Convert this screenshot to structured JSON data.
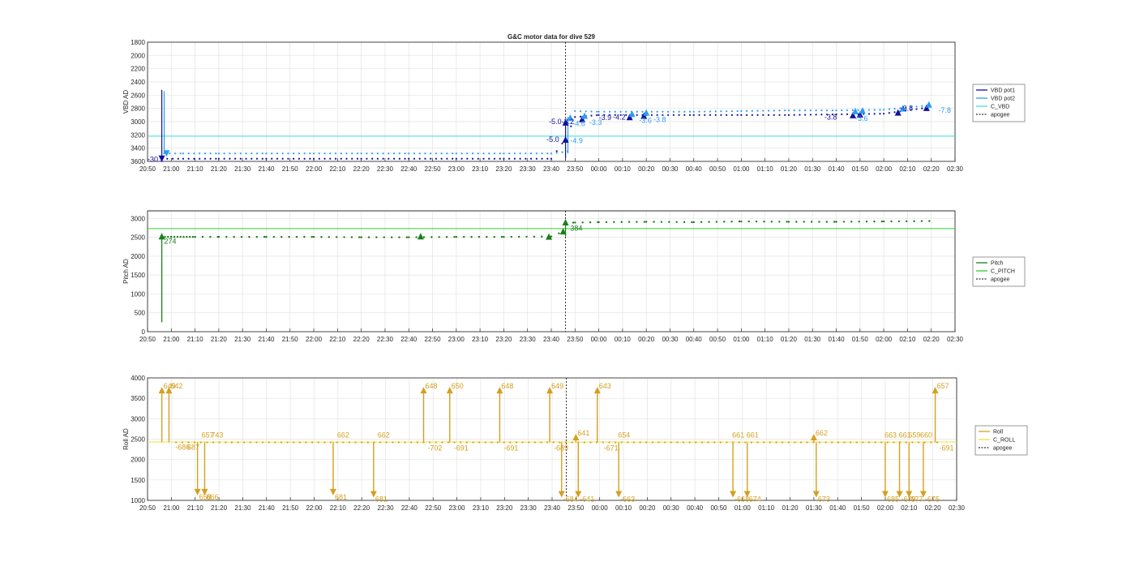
{
  "figure": {
    "title": "G&C motor data for dive 529"
  },
  "chart_data": [
    {
      "type": "line",
      "ylabel": "VBD AD",
      "xlabel": "",
      "ylim": [
        1800,
        3600
      ],
      "y_reversed": true,
      "yticks": [
        1800,
        2000,
        2200,
        2400,
        2600,
        2800,
        3000,
        3200,
        3400,
        3600
      ],
      "xticks": [
        "20:50",
        "21:00",
        "21:10",
        "21:20",
        "21:30",
        "21:40",
        "21:50",
        "22:00",
        "22:10",
        "22:20",
        "22:30",
        "22:40",
        "22:50",
        "23:00",
        "23:10",
        "23:20",
        "23:30",
        "23:40",
        "23:50",
        "00:00",
        "00:10",
        "00:20",
        "00:30",
        "00:40",
        "00:50",
        "01:00",
        "01:10",
        "01:20",
        "01:30",
        "01:40",
        "01:50",
        "02:00",
        "02:10",
        "02:20",
        "02:30"
      ],
      "grid": true,
      "legend_position": "right",
      "legend": [
        "VBD pot1",
        "VBD pot2",
        "C_VBD",
        "apogee"
      ],
      "colors": {
        "pot1": "#1010a0",
        "pot2": "#2a9df4",
        "c_vbd": "#40e0e0",
        "apogee": "#000000"
      },
      "apogee_x": "23:46",
      "c_vbd_value": 3220,
      "series": [
        {
          "name": "VBD pot1",
          "x": [
            "20:56",
            "21:05",
            "21:20",
            "21:40",
            "22:00",
            "22:20",
            "22:40",
            "23:00",
            "23:20",
            "23:40",
            "23:46",
            "23:50",
            "00:00",
            "00:20",
            "00:40",
            "01:00",
            "01:20",
            "01:40",
            "02:00",
            "02:20"
          ],
          "values": [
            3560,
            3560,
            3560,
            3560,
            3560,
            3560,
            3560,
            3560,
            3560,
            3560,
            3260,
            2930,
            2900,
            2900,
            2900,
            2900,
            2900,
            2890,
            2880,
            2780
          ]
        },
        {
          "name": "VBD pot2",
          "x": [
            "20:57",
            "21:05",
            "21:20",
            "21:40",
            "22:00",
            "22:20",
            "22:40",
            "23:00",
            "23:20",
            "23:40",
            "23:47",
            "23:50",
            "00:00",
            "00:20",
            "00:40",
            "01:00",
            "01:20",
            "01:40",
            "02:00",
            "02:20"
          ],
          "values": [
            3480,
            3480,
            3480,
            3480,
            3480,
            3480,
            3480,
            3480,
            3480,
            3480,
            3450,
            2840,
            2850,
            2850,
            2850,
            2840,
            2830,
            2830,
            2820,
            2750
          ]
        }
      ],
      "annotations": [
        {
          "x": "20:50",
          "y": 3570,
          "text": "-30.2",
          "color": "#1010a0"
        },
        {
          "x": "23:39",
          "y": 3000,
          "text": "-5.0-3.2",
          "color": "#1010a0"
        },
        {
          "x": "23:38",
          "y": 3270,
          "text": "-5.0",
          "color": "#1010a0"
        },
        {
          "x": "23:49",
          "y": 3030,
          "text": "-4.6",
          "color": "#2a9df4"
        },
        {
          "x": "23:56",
          "y": 3010,
          "text": "-3.3",
          "color": "#2a9df4"
        },
        {
          "x": "23:48",
          "y": 3290,
          "text": "-4.9",
          "color": "#2a9df4"
        },
        {
          "x": "00:00",
          "y": 2940,
          "text": "-3.9",
          "color": "#1010a0"
        },
        {
          "x": "00:06",
          "y": 2930,
          "text": "-4.2",
          "color": "#1010a0"
        },
        {
          "x": "00:17",
          "y": 2980,
          "text": "-3.6",
          "color": "#2a9df4"
        },
        {
          "x": "00:23",
          "y": 2970,
          "text": "-3.8",
          "color": "#2a9df4"
        },
        {
          "x": "01:35",
          "y": 2930,
          "text": "-3.8",
          "color": "#1010a0"
        },
        {
          "x": "01:48",
          "y": 2950,
          "text": "-3.6",
          "color": "#2a9df4"
        },
        {
          "x": "02:07",
          "y": 2800,
          "text": "-9.8",
          "color": "#1010a0"
        },
        {
          "x": "02:23",
          "y": 2830,
          "text": "-7.8",
          "color": "#2a9df4"
        }
      ],
      "markers": [
        {
          "x": "20:56",
          "y": 3560,
          "dir": "down",
          "color": "#1010a0"
        },
        {
          "x": "20:58",
          "y": 3480,
          "dir": "down",
          "color": "#2a9df4"
        },
        {
          "x": "23:46",
          "y": 3270,
          "dir": "up",
          "color": "#1010a0"
        },
        {
          "x": "23:46",
          "y": 3010,
          "dir": "up",
          "color": "#1010a0"
        },
        {
          "x": "23:48",
          "y": 2940,
          "dir": "up",
          "color": "#2a9df4"
        },
        {
          "x": "23:53",
          "y": 2960,
          "dir": "up",
          "color": "#1010a0"
        },
        {
          "x": "23:54",
          "y": 2910,
          "dir": "up",
          "color": "#2a9df4"
        },
        {
          "x": "00:13",
          "y": 2930,
          "dir": "up",
          "color": "#1010a0"
        },
        {
          "x": "00:14",
          "y": 2880,
          "dir": "up",
          "color": "#2a9df4"
        },
        {
          "x": "00:19",
          "y": 2910,
          "dir": "up",
          "color": "#1010a0"
        },
        {
          "x": "00:20",
          "y": 2860,
          "dir": "up",
          "color": "#2a9df4"
        },
        {
          "x": "01:47",
          "y": 2900,
          "dir": "up",
          "color": "#1010a0"
        },
        {
          "x": "01:48",
          "y": 2840,
          "dir": "up",
          "color": "#2a9df4"
        },
        {
          "x": "01:50",
          "y": 2890,
          "dir": "up",
          "color": "#1010a0"
        },
        {
          "x": "01:51",
          "y": 2830,
          "dir": "up",
          "color": "#2a9df4"
        },
        {
          "x": "02:06",
          "y": 2860,
          "dir": "up",
          "color": "#1010a0"
        },
        {
          "x": "02:08",
          "y": 2800,
          "dir": "up",
          "color": "#2a9df4"
        },
        {
          "x": "02:18",
          "y": 2790,
          "dir": "up",
          "color": "#1010a0"
        },
        {
          "x": "02:19",
          "y": 2740,
          "dir": "up",
          "color": "#2a9df4"
        }
      ]
    },
    {
      "type": "line",
      "ylabel": "Pitch AD",
      "xlabel": "",
      "ylim": [
        0,
        3200
      ],
      "yticks": [
        0,
        500,
        1000,
        1500,
        2000,
        2500,
        3000
      ],
      "xticks": [
        "20:50",
        "21:00",
        "21:10",
        "21:20",
        "21:30",
        "21:40",
        "21:50",
        "22:00",
        "22:10",
        "22:20",
        "22:30",
        "22:40",
        "22:50",
        "23:00",
        "23:10",
        "23:20",
        "23:30",
        "23:40",
        "23:50",
        "00:00",
        "00:10",
        "00:20",
        "00:30",
        "00:40",
        "00:50",
        "01:00",
        "01:10",
        "01:20",
        "01:30",
        "01:40",
        "01:50",
        "02:00",
        "02:10",
        "02:20",
        "02:30"
      ],
      "grid": true,
      "legend_position": "right",
      "legend": [
        "Pitch",
        "C_PITCH",
        "apogee"
      ],
      "colors": {
        "pitch": "#1a7f1a",
        "c_pitch": "#33cc33",
        "apogee": "#000000"
      },
      "apogee_x": "23:46",
      "c_pitch_value": 2730,
      "series": [
        {
          "name": "Pitch",
          "x": [
            "20:56",
            "21:00",
            "21:10",
            "21:20",
            "21:40",
            "22:00",
            "22:20",
            "22:40",
            "23:00",
            "23:20",
            "23:40",
            "23:45",
            "23:46",
            "23:50",
            "00:00",
            "00:20",
            "00:40",
            "01:00",
            "01:20",
            "01:40",
            "02:00",
            "02:20"
          ],
          "values": [
            2510,
            2510,
            2510,
            2510,
            2510,
            2510,
            2500,
            2500,
            2510,
            2510,
            2520,
            2650,
            2880,
            2890,
            2900,
            2910,
            2900,
            2920,
            2910,
            2910,
            2920,
            2930
          ]
        }
      ],
      "annotations": [
        {
          "x": "20:57",
          "y": 2390,
          "text": "274"
        },
        {
          "x": "23:48",
          "y": 2740,
          "text": "384"
        }
      ],
      "markers": [
        {
          "x": "20:56",
          "y": 2530,
          "dir": "up"
        },
        {
          "x": "22:45",
          "y": 2530,
          "dir": "up"
        },
        {
          "x": "23:39",
          "y": 2520,
          "dir": "up"
        },
        {
          "x": "23:45",
          "y": 2660,
          "dir": "up"
        },
        {
          "x": "23:46",
          "y": 2900,
          "dir": "up"
        }
      ],
      "vertical_spikes": [
        {
          "x": "20:56",
          "from": 2510,
          "to": 250
        }
      ]
    },
    {
      "type": "line",
      "ylabel": "Roll AD",
      "xlabel": "",
      "ylim": [
        1000,
        4000
      ],
      "yticks": [
        1000,
        1500,
        2000,
        2500,
        3000,
        3500,
        4000
      ],
      "xticks": [
        "20:50",
        "21:00",
        "21:10",
        "21:20",
        "21:30",
        "21:40",
        "21:50",
        "22:00",
        "22:10",
        "22:20",
        "22:30",
        "22:40",
        "22:50",
        "23:00",
        "23:10",
        "23:20",
        "23:30",
        "23:40",
        "23:50",
        "00:00",
        "00:10",
        "00:20",
        "00:30",
        "00:40",
        "00:50",
        "01:00",
        "01:10",
        "01:20",
        "01:30",
        "01:40",
        "01:50",
        "02:00",
        "02:10",
        "02:20",
        "02:30"
      ],
      "grid": true,
      "legend_position": "right",
      "legend": [
        "Roll",
        "C_ROLL",
        "apogee"
      ],
      "colors": {
        "roll": "#d4a020",
        "c_roll": "#f0e040",
        "apogee": "#000000"
      },
      "apogee_x": "23:46",
      "c_roll_value": 2430,
      "baseline": 2420,
      "spikes": [
        {
          "x": "20:56",
          "peak": 3700,
          "label": "649"
        },
        {
          "x": "20:59",
          "peak": 3700,
          "label": "642"
        },
        {
          "x": "21:01",
          "peak": 2420,
          "label": "-686"
        },
        {
          "x": "21:06",
          "peak": 2420,
          "label": "687"
        },
        {
          "x": "21:11",
          "peak": 1200,
          "label": "658"
        },
        {
          "x": "21:14",
          "peak": 1200,
          "label": "666"
        },
        {
          "x": "21:12",
          "peak": 2500,
          "label": "657"
        },
        {
          "x": "21:16",
          "peak": 2500,
          "label": "743"
        },
        {
          "x": "22:08",
          "peak": 1200,
          "label": "681"
        },
        {
          "x": "22:09",
          "peak": 2500,
          "label": "662"
        },
        {
          "x": "22:25",
          "peak": 1150,
          "label": "681"
        },
        {
          "x": "22:26",
          "peak": 2500,
          "label": "662"
        },
        {
          "x": "22:46",
          "peak": 3700,
          "label": "648"
        },
        {
          "x": "22:47",
          "peak": 2400,
          "label": "-702"
        },
        {
          "x": "22:57",
          "peak": 3700,
          "label": "650"
        },
        {
          "x": "22:58",
          "peak": 2400,
          "label": "-691"
        },
        {
          "x": "23:18",
          "peak": 3700,
          "label": "648"
        },
        {
          "x": "23:19",
          "peak": 2400,
          "label": "-691"
        },
        {
          "x": "23:39",
          "peak": 3700,
          "label": "649"
        },
        {
          "x": "23:40",
          "peak": 2400,
          "label": "-689"
        },
        {
          "x": "23:44",
          "peak": 1150,
          "label": "-684"
        },
        {
          "x": "23:50",
          "peak": 2550,
          "label": "641"
        },
        {
          "x": "23:51",
          "peak": 1150,
          "label": "-641"
        },
        {
          "x": "23:59",
          "peak": 3700,
          "label": "643"
        },
        {
          "x": "00:01",
          "peak": 2400,
          "label": "-671"
        },
        {
          "x": "00:07",
          "peak": 2500,
          "label": "654"
        },
        {
          "x": "00:08",
          "peak": 1150,
          "label": "-663"
        },
        {
          "x": "00:55",
          "peak": 2500,
          "label": "661"
        },
        {
          "x": "00:56",
          "peak": 1150,
          "label": "-668"
        },
        {
          "x": "01:01",
          "peak": 2500,
          "label": "661"
        },
        {
          "x": "01:02",
          "peak": 1150,
          "label": "674"
        },
        {
          "x": "01:30",
          "peak": 2550,
          "label": "662"
        },
        {
          "x": "01:31",
          "peak": 1150,
          "label": "673"
        },
        {
          "x": "01:59",
          "peak": 2500,
          "label": "663"
        },
        {
          "x": "02:00",
          "peak": 1150,
          "label": "685"
        },
        {
          "x": "02:05",
          "peak": 2500,
          "label": "661"
        },
        {
          "x": "02:06",
          "peak": 1150,
          "label": "-679"
        },
        {
          "x": "02:09",
          "peak": 2500,
          "label": "659"
        },
        {
          "x": "02:10",
          "peak": 1150,
          "label": "677"
        },
        {
          "x": "02:14",
          "peak": 2500,
          "label": "660"
        },
        {
          "x": "02:16",
          "peak": 1150,
          "label": "-675"
        },
        {
          "x": "02:21",
          "peak": 3700,
          "label": "657"
        },
        {
          "x": "02:22",
          "peak": 2400,
          "label": "-691"
        }
      ]
    }
  ]
}
